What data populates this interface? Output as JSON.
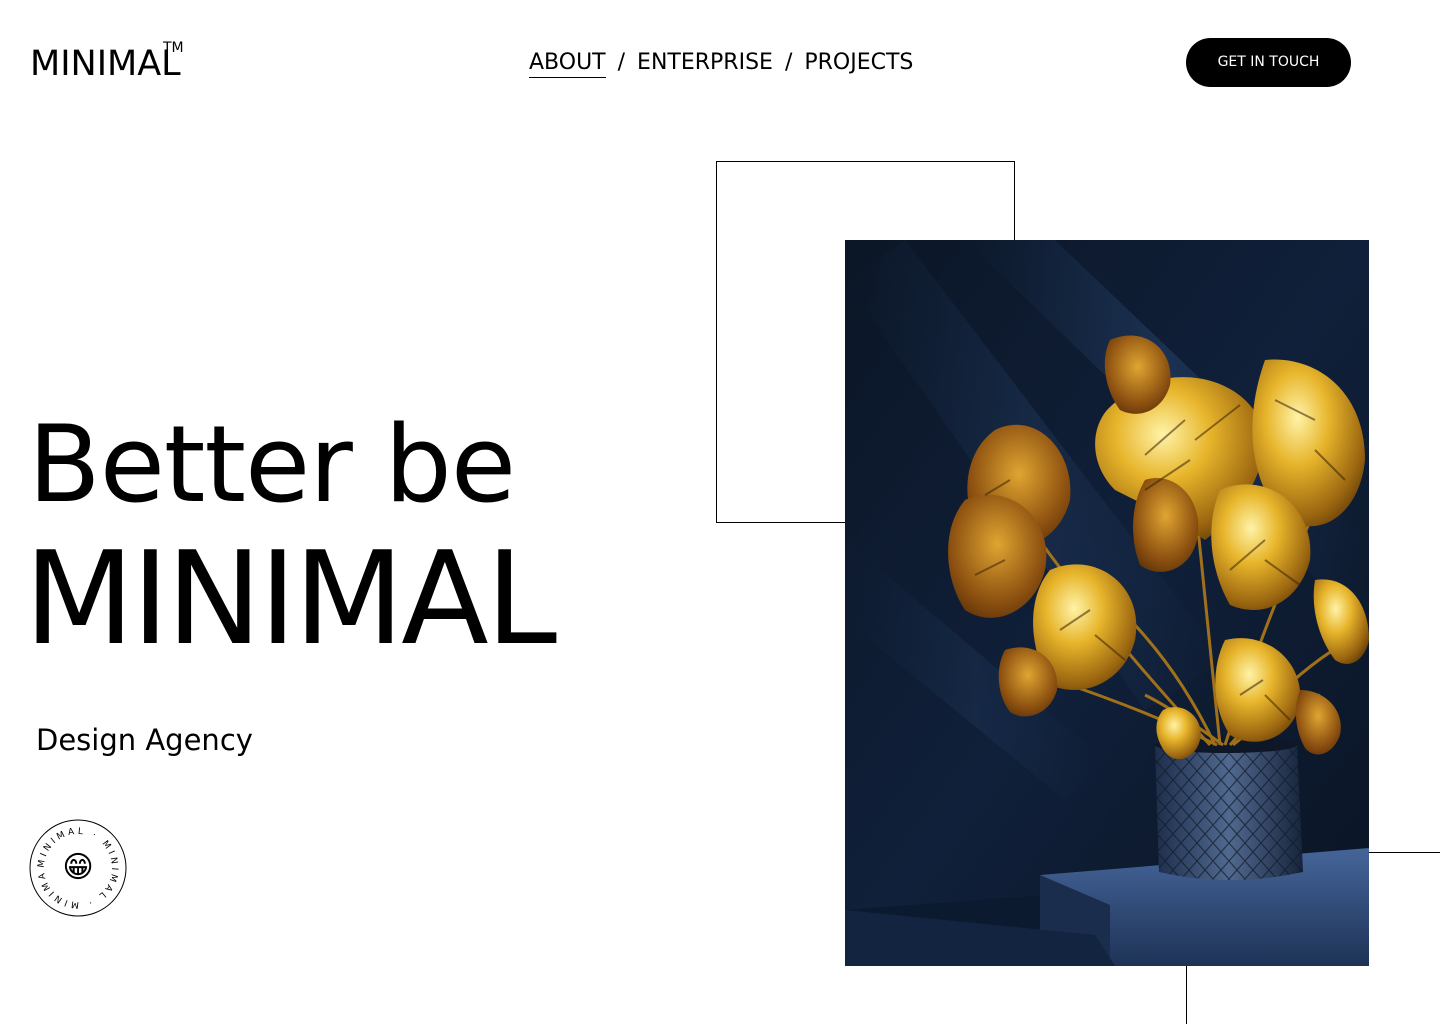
{
  "header": {
    "logo": "MINIMAL",
    "logo_mark": "TM",
    "nav": [
      {
        "label": "ABOUT",
        "active": true
      },
      {
        "label": "ENTERPRISE",
        "active": false
      },
      {
        "label": "PROJECTS",
        "active": false
      }
    ],
    "nav_separator": "/",
    "cta_label": "GET IN TOUCH"
  },
  "hero": {
    "line1": "Better be",
    "line2": "MINIMAL",
    "subtitle": "Design Agency"
  },
  "badge": {
    "ring_text": "MINIMAL · MINIMAL · MINIMAL ·",
    "emoji": "😁"
  },
  "image": {
    "subject": "golden monstera plant in dark blue textured pot"
  },
  "colors": {
    "background": "#ffffff",
    "text": "#000000",
    "button_bg": "#000000",
    "button_text": "#ffffff",
    "photo_bg": "#0e1a2c",
    "gold": "#d9a520"
  }
}
